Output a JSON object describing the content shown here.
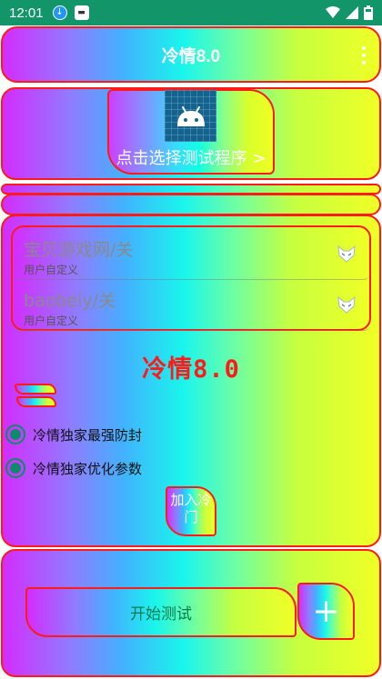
{
  "status_bar": {
    "time": "12:01",
    "icons": [
      "download-icon",
      "sim-manager-icon",
      "wifi-icon",
      "signal-icon",
      "battery-icon"
    ]
  },
  "app_bar": {
    "title": "冷情8.0",
    "menu_icon": "more-vert-icon"
  },
  "select_program": {
    "icon": "android-icon",
    "label": "点击选择测试程序 >"
  },
  "list": {
    "items": [
      {
        "title": "宝贝游戏网/关",
        "subtitle": "用户自定义",
        "icon": "fox-mask-icon"
      },
      {
        "title": "baobeiy/关",
        "subtitle": "用户自定义",
        "icon": "fox-mask-icon"
      }
    ]
  },
  "headline": "冷情8.0",
  "options": [
    {
      "label": "冷情独家最强防封",
      "selected": true
    },
    {
      "label": "冷情独家优化参数",
      "selected": true
    }
  ],
  "join_button": {
    "label": "加入冷门"
  },
  "start_button": {
    "label": "开始测试"
  },
  "add_button": {
    "icon": "plus-icon"
  },
  "colors": {
    "status_bar": "#13956a",
    "border": "#ff1a1a",
    "headline": "#ff1a1a",
    "radio": "#0d8a6a",
    "start_text": "#0e7a4e"
  }
}
